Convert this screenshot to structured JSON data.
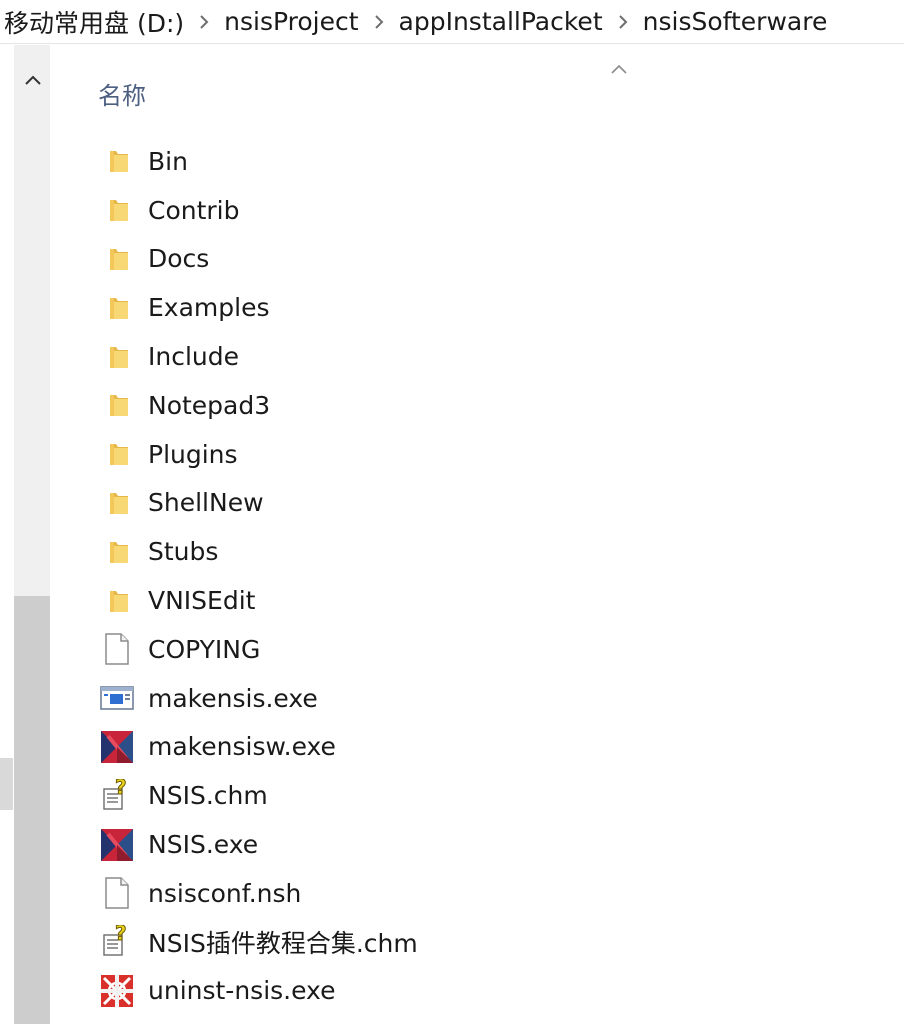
{
  "breadcrumb": {
    "items": [
      "移动常用盘 (D:)",
      "nsisProject",
      "appInstallPacket",
      "nsisSofterware"
    ]
  },
  "file_list": {
    "column_header": "名称",
    "items": [
      {
        "name": "Bin",
        "icon": "folder-icon"
      },
      {
        "name": "Contrib",
        "icon": "folder-icon"
      },
      {
        "name": "Docs",
        "icon": "folder-icon"
      },
      {
        "name": "Examples",
        "icon": "folder-icon"
      },
      {
        "name": "Include",
        "icon": "folder-icon"
      },
      {
        "name": "Notepad3",
        "icon": "folder-icon"
      },
      {
        "name": "Plugins",
        "icon": "folder-icon"
      },
      {
        "name": "ShellNew",
        "icon": "folder-icon"
      },
      {
        "name": "Stubs",
        "icon": "folder-icon"
      },
      {
        "name": "VNISEdit",
        "icon": "folder-icon"
      },
      {
        "name": "COPYING",
        "icon": "blank-file-icon"
      },
      {
        "name": "makensis.exe",
        "icon": "console-app-icon"
      },
      {
        "name": "makensisw.exe",
        "icon": "nsis-app-icon"
      },
      {
        "name": "NSIS.chm",
        "icon": "help-file-icon"
      },
      {
        "name": "NSIS.exe",
        "icon": "nsis-app-icon"
      },
      {
        "name": "nsisconf.nsh",
        "icon": "blank-file-icon"
      },
      {
        "name": "NSIS插件教程合集.chm",
        "icon": "help-file-icon"
      },
      {
        "name": "uninst-nsis.exe",
        "icon": "uninstaller-icon"
      }
    ]
  },
  "colors": {
    "folder": "#f8d775",
    "folder_dark": "#e6b84a",
    "header_text": "#4d6082",
    "nsis_red": "#c8243a",
    "nsis_navy": "#24336e"
  }
}
